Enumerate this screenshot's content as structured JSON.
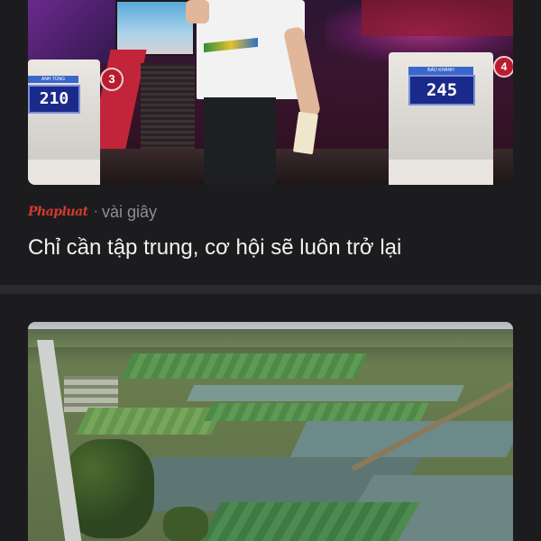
{
  "feed": {
    "items": [
      {
        "image_alt": "",
        "source": "Phapluat",
        "time": "vài giây",
        "separator": "·",
        "headline": "Chỉ cần tập trung, cơ hội sẽ luôn trở lại",
        "podiums": [
          {
            "name": "ANH TÙNG",
            "score": "210",
            "number": "3"
          },
          {
            "name": "BẢO KHÁNH",
            "score": "245",
            "number": "4"
          }
        ]
      },
      {
        "image_alt": ""
      }
    ]
  },
  "colors": {
    "background": "#1c1c1e",
    "divider": "#2a2a2c",
    "source_brand": "#d23a2e",
    "meta_text": "#8e8e93",
    "headline_text": "#f2f2f2"
  }
}
